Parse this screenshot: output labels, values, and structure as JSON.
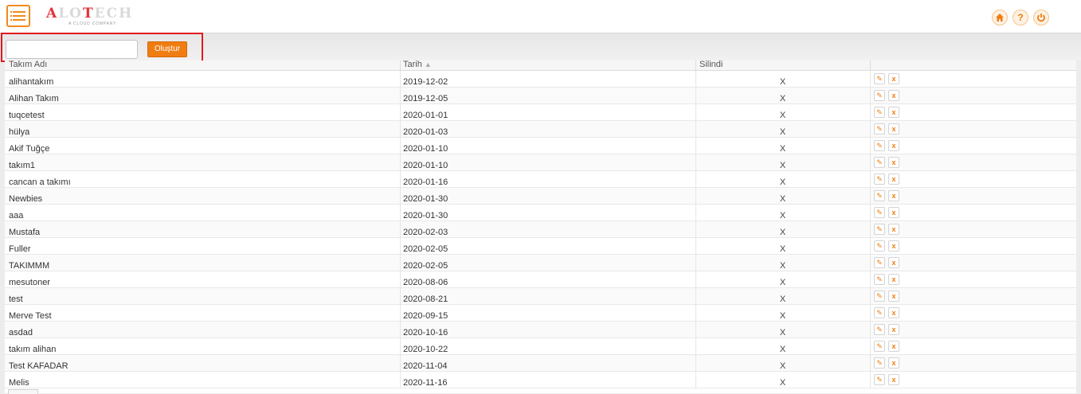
{
  "header": {
    "logo_prefix": "A",
    "logo_rest": "LO",
    "logo_mid": "T",
    "logo_end": "ECH",
    "logo_tagline": "A CLOUD COMPANY",
    "icons": [
      "home-icon",
      "help-icon",
      "power-icon"
    ],
    "help_glyph": "?",
    "accent_color": "#f07d12",
    "logo_color": "#e2333a"
  },
  "creator": {
    "input_value": "",
    "input_placeholder": "",
    "button_label": "Oluştur"
  },
  "table": {
    "columns": [
      "Takım Adı",
      "Tarih",
      "Silindi"
    ],
    "sort_indicator": "▲",
    "rows": [
      {
        "name": "alihantakım",
        "date": "2019-12-02",
        "deleted": "X"
      },
      {
        "name": "Alihan  Takım",
        "date": "2019-12-05",
        "deleted": "X"
      },
      {
        "name": "tuqcetest",
        "date": "2020-01-01",
        "deleted": "X"
      },
      {
        "name": "hülya",
        "date": "2020-01-03",
        "deleted": "X"
      },
      {
        "name": "Akif Tuğçe",
        "date": "2020-01-10",
        "deleted": "X"
      },
      {
        "name": "takım1",
        "date": "2020-01-10",
        "deleted": "X"
      },
      {
        "name": "cancan a takımı",
        "date": "2020-01-16",
        "deleted": "X"
      },
      {
        "name": "Newbies",
        "date": "2020-01-30",
        "deleted": "X"
      },
      {
        "name": "aaa",
        "date": "2020-01-30",
        "deleted": "X"
      },
      {
        "name": "Mustafa",
        "date": "2020-02-03",
        "deleted": "X"
      },
      {
        "name": "Fuller",
        "date": "2020-02-05",
        "deleted": "X"
      },
      {
        "name": "TAKIMMM",
        "date": "2020-02-05",
        "deleted": "X"
      },
      {
        "name": "mesutoner",
        "date": "2020-08-06",
        "deleted": "X"
      },
      {
        "name": "test",
        "date": "2020-08-21",
        "deleted": "X"
      },
      {
        "name": "Merve Test",
        "date": "2020-09-15",
        "deleted": "X"
      },
      {
        "name": "asdad",
        "date": "2020-10-16",
        "deleted": "X"
      },
      {
        "name": "takım  alihan",
        "date": "2020-10-22",
        "deleted": "X"
      },
      {
        "name": "Test  KAFADAR",
        "date": "2020-11-04",
        "deleted": "X"
      },
      {
        "name": "Melis",
        "date": "2020-11-16",
        "deleted": "X"
      }
    ],
    "edit_glyph": "✎",
    "delete_glyph": "x"
  }
}
